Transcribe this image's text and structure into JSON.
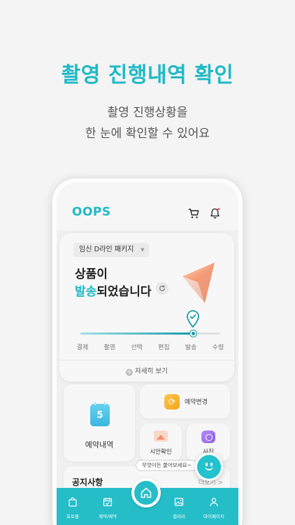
{
  "promo": {
    "title": "촬영 진행내역 확인",
    "subtitle_line1": "촬영 진행상황을",
    "subtitle_line2": "한 눈에 확인할 수 있어요"
  },
  "app": {
    "logo": "OOPS",
    "brand_color": "#1fb9c6"
  },
  "status_card": {
    "package_select": "임신 D라인 패키지",
    "headline_line1": "상품이",
    "headline_highlight": "발송",
    "headline_rest": "되었습니다",
    "steps": [
      "결제",
      "촬영",
      "선택",
      "편집",
      "발송",
      "수령"
    ],
    "current_step": 4,
    "details_link": "자세히 보기"
  },
  "tiles": {
    "reservation": {
      "number": "5",
      "label": "예약내역"
    },
    "change": {
      "label": "예약변경"
    },
    "proof": {
      "label": "시안확인"
    },
    "photo": {
      "label": "사진"
    }
  },
  "chatbot": {
    "bubble": "무엇이든 물어보세요~"
  },
  "notice": {
    "title": "공지사항",
    "more": "더보기 >"
  },
  "bottom_nav": {
    "items": [
      {
        "label": "포토몰",
        "icon": "shopping-bag-icon"
      },
      {
        "label": "계약/예약",
        "icon": "calendar-check-icon"
      },
      {
        "label": "갤러리",
        "icon": "image-icon"
      },
      {
        "label": "마이페이지",
        "icon": "person-icon"
      }
    ]
  }
}
